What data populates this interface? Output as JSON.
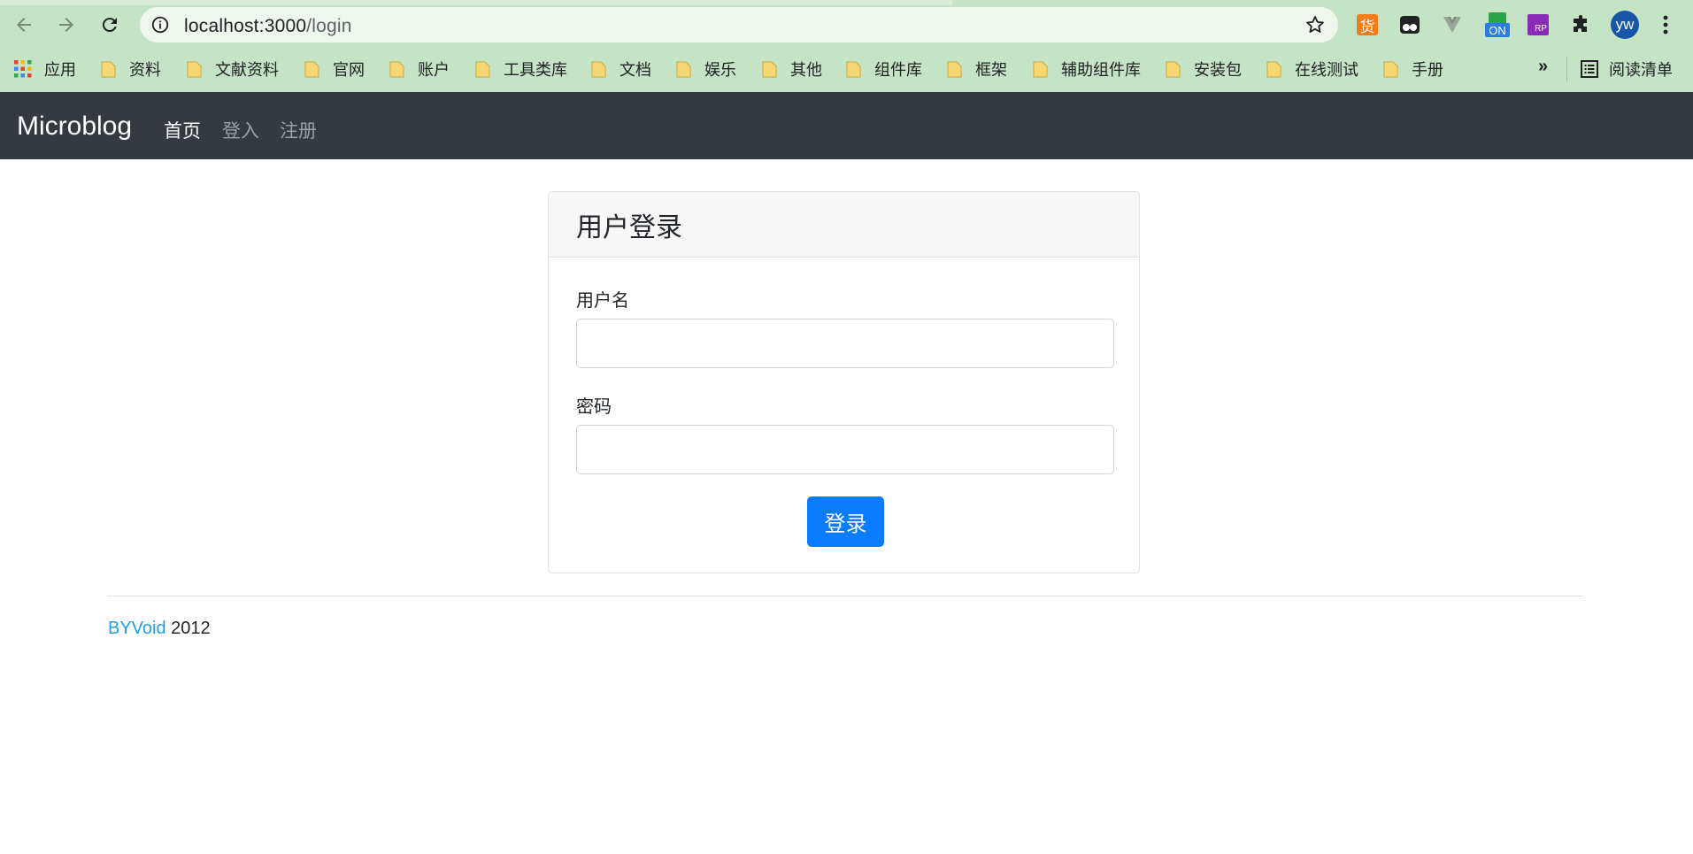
{
  "browser": {
    "url_host": "localhost:3000",
    "url_path": "/login",
    "avatar_initials": "yw",
    "extensions": [
      "huo-extension-icon",
      "tampermonkey-icon",
      "vue-devtools-icon",
      "on-extension-icon",
      "rp-extension-icon",
      "puzzle-icon"
    ],
    "ext_on_label": "ON",
    "ext_rp_label": "RP",
    "ext_huo_label": "货",
    "bookmarks": [
      {
        "label": "应用"
      },
      {
        "label": "资料"
      },
      {
        "label": "文献资料"
      },
      {
        "label": "官网"
      },
      {
        "label": "账户"
      },
      {
        "label": "工具类库"
      },
      {
        "label": "文档"
      },
      {
        "label": "娱乐"
      },
      {
        "label": "其他"
      },
      {
        "label": "组件库"
      },
      {
        "label": "框架"
      },
      {
        "label": "辅助组件库"
      },
      {
        "label": "安装包"
      },
      {
        "label": "在线测试"
      },
      {
        "label": "手册"
      }
    ],
    "bookmarks_more": "»",
    "reading_list": "阅读清单",
    "colors": {
      "chrome": "#c5e3c5",
      "omnibox": "#eef6ee",
      "folder": "#f7d774"
    }
  },
  "navbar": {
    "brand": "Microblog",
    "links": [
      {
        "label": "首页",
        "state": "active"
      },
      {
        "label": "登入",
        "state": "muted"
      },
      {
        "label": "注册",
        "state": "muted"
      }
    ],
    "colors": {
      "background": "#343a40"
    }
  },
  "login_card": {
    "title": "用户登录",
    "username_label": "用户名",
    "username_value": "",
    "password_label": "密码",
    "password_value": "",
    "submit_label": "登录",
    "colors": {
      "button": "#0b7bff"
    }
  },
  "footer": {
    "link_text": "BYVoid",
    "year": " 2012",
    "colors": {
      "link": "#1da1e2"
    }
  }
}
